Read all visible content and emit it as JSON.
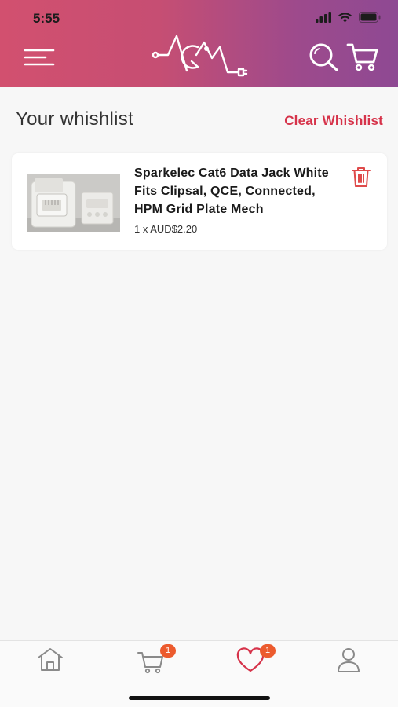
{
  "status_bar": {
    "time": "5:55"
  },
  "header": {
    "logo_icon": "acm-logo-icon",
    "menu_icon": "menu-icon",
    "search_icon": "search-icon",
    "cart_icon": "cart-icon"
  },
  "colors": {
    "header_start": "#d2506f",
    "header_end": "#8e4993",
    "accent_red": "#d6334a",
    "badge": "#ec5b2e"
  },
  "page": {
    "title": "Your whishlist",
    "clear_label": "Clear Whishlist"
  },
  "wishlist": {
    "items": [
      {
        "name": "Sparkelec Cat6 Data Jack White Fits Clipsal, QCE, Connected, HPM Grid Plate Mech",
        "price": "1 x AUD$2.20",
        "image_icon": "data-jack-product-image"
      }
    ]
  },
  "tabbar": {
    "tabs": [
      {
        "icon": "home-icon",
        "badge": ""
      },
      {
        "icon": "cart-icon",
        "badge": "1"
      },
      {
        "icon": "heart-icon",
        "badge": "1"
      },
      {
        "icon": "user-icon",
        "badge": ""
      }
    ]
  }
}
